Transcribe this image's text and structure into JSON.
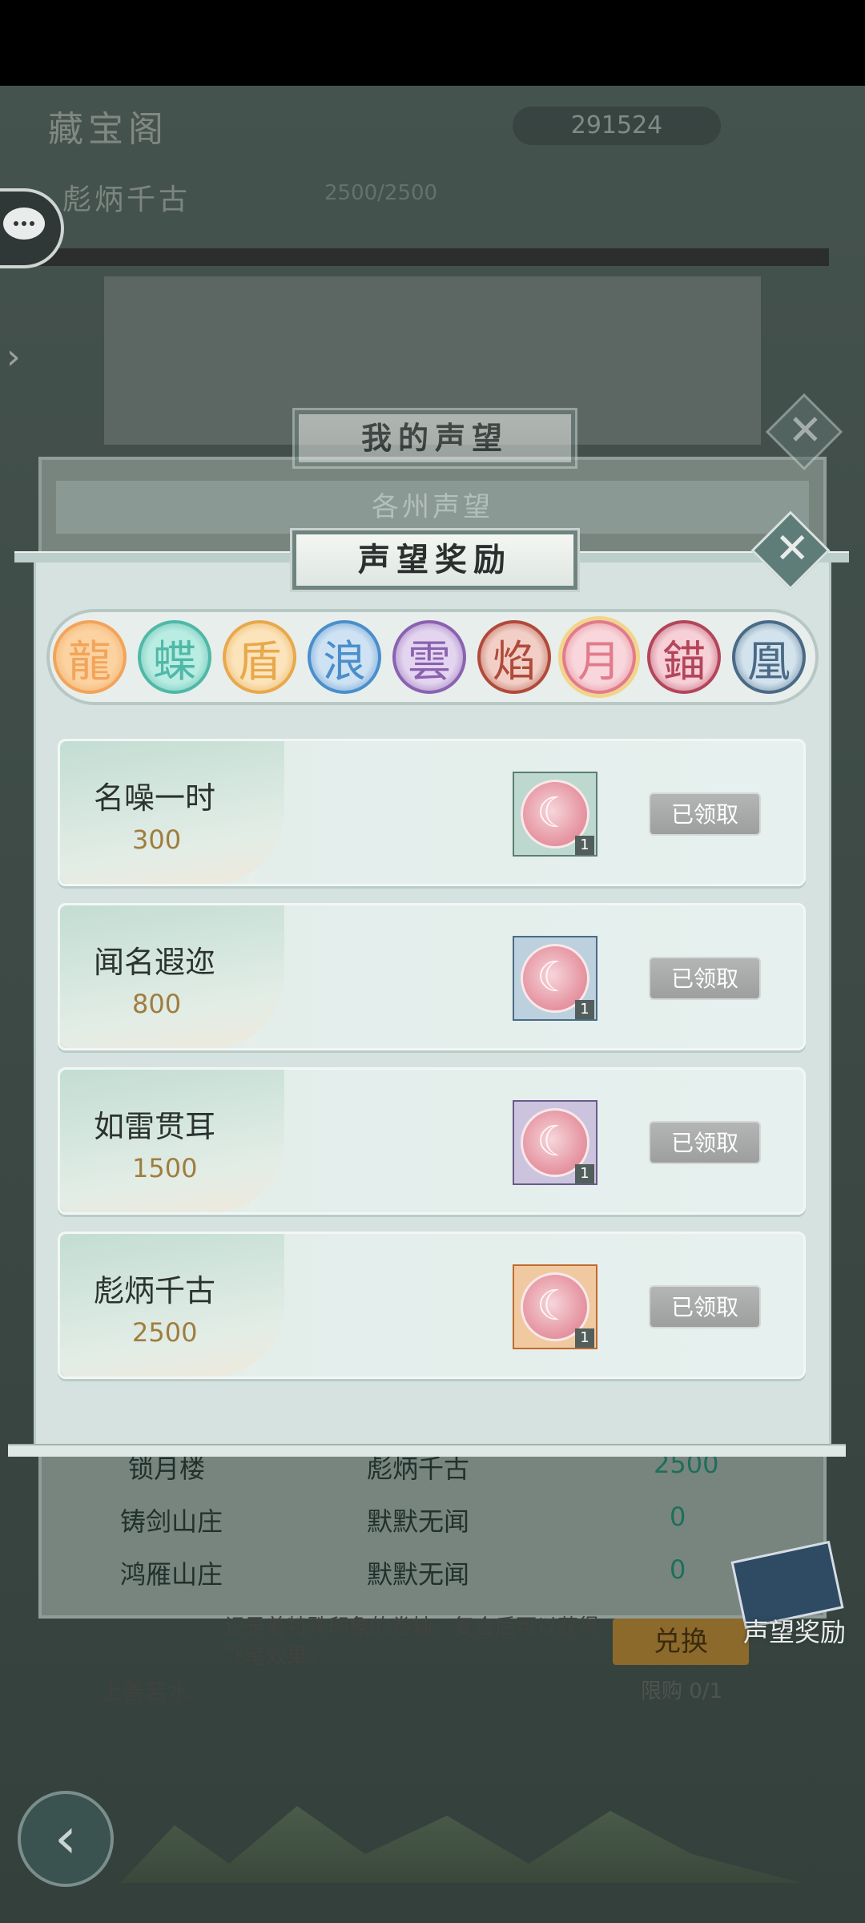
{
  "hud": {
    "shop_title": "藏宝阁",
    "currency_value": "291524",
    "rank_title": "彪炳千古",
    "rank_progress": "2500/2500"
  },
  "back_panel": {
    "title": "我的声望",
    "tab_label": "各州声望",
    "rows": [
      {
        "name": "锁月楼",
        "rank": "彪炳千古",
        "value": "2500"
      },
      {
        "name": "铸剑山庄",
        "rank": "默默无闻",
        "value": "0"
      },
      {
        "name": "鸿雁山庄",
        "rank": "默默无闻",
        "value": "0"
      }
    ],
    "item_desc": "记录着特殊印象的卷轴，复合后可以获得飞笔效果。",
    "exchange_label": "兑换",
    "limit_text": "限购 0/1",
    "seller": "上善若水"
  },
  "reward_panel": {
    "title": "声望奖励",
    "seals": [
      {
        "icon": "dragon-seal-icon",
        "glyph": "龍",
        "color": "#f2a45a",
        "bg": "#fbd2a0"
      },
      {
        "icon": "butterfly-seal-icon",
        "glyph": "蝶",
        "color": "#4fb8a7",
        "bg": "#b9ece2"
      },
      {
        "icon": "shield-seal-icon",
        "glyph": "盾",
        "color": "#e8a84c",
        "bg": "#fbe4bb"
      },
      {
        "icon": "wave-seal-icon",
        "glyph": "浪",
        "color": "#4a8ecb",
        "bg": "#cfe2f3"
      },
      {
        "icon": "cloud-seal-icon",
        "glyph": "雲",
        "color": "#8a62b0",
        "bg": "#e3d4ef"
      },
      {
        "icon": "flame-seal-icon",
        "glyph": "焰",
        "color": "#b04a3a",
        "bg": "#f1cfc6"
      },
      {
        "icon": "moon-seal-icon",
        "glyph": "月",
        "color": "#e27b8c",
        "bg": "#f8d6db"
      },
      {
        "icon": "anchor-seal-icon",
        "glyph": "錨",
        "color": "#b3455a",
        "bg": "#f6cfd7"
      },
      {
        "icon": "phoenix-seal-icon",
        "glyph": "凰",
        "color": "#4a6a86",
        "bg": "#d3e3ee"
      }
    ],
    "selected_seal": 6,
    "rewards": [
      {
        "title": "名噪一时",
        "points": "300",
        "count": "1",
        "frame": "#5d7d75",
        "tint": "#bcd8cf",
        "button": "已领取"
      },
      {
        "title": "闻名遐迩",
        "points": "800",
        "count": "1",
        "frame": "#4a6b86",
        "tint": "#bcd0de",
        "button": "已领取"
      },
      {
        "title": "如雷贯耳",
        "points": "1500",
        "count": "1",
        "frame": "#6a5a8a",
        "tint": "#ccc4de",
        "button": "已领取"
      },
      {
        "title": "彪炳千古",
        "points": "2500",
        "count": "1",
        "frame": "#c06a2c",
        "tint": "#f0c9a0",
        "button": "已领取"
      }
    ]
  },
  "side_button": {
    "label": "声望奖励"
  }
}
